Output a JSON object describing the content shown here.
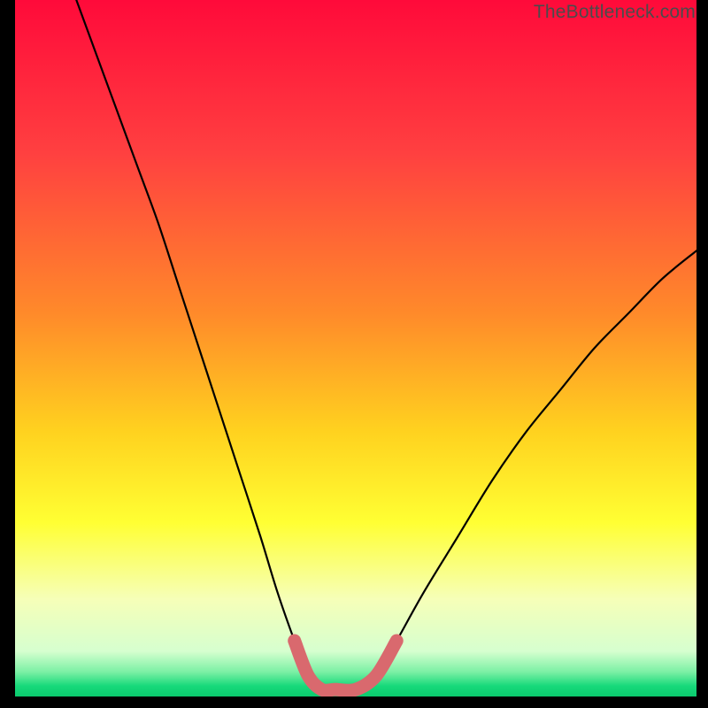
{
  "watermark": "TheBottleneck.com",
  "chart_data": {
    "type": "line",
    "title": "",
    "xlabel": "",
    "ylabel": "",
    "xlim": [
      0,
      100
    ],
    "ylim": [
      0,
      100
    ],
    "grid": false,
    "legend": false,
    "series": [
      {
        "name": "bottleneck-curve",
        "x": [
          9,
          12,
          15,
          18,
          21,
          24,
          27,
          30,
          33,
          36,
          38.5,
          41,
          43,
          45,
          47,
          50,
          53,
          56,
          60,
          65,
          70,
          75,
          80,
          85,
          90,
          95,
          100
        ],
        "y": [
          100,
          92,
          84,
          76,
          68,
          59,
          50,
          41,
          32,
          23,
          15,
          8,
          3,
          1,
          1,
          1,
          3,
          8,
          15,
          23,
          31,
          38,
          44,
          50,
          55,
          60,
          64
        ]
      }
    ],
    "highlight_band": {
      "name": "optimal-range",
      "x_start": 41,
      "x_end": 56,
      "color": "#d9696e"
    },
    "gradient_stops": [
      {
        "offset": 0.0,
        "color": "#ff0a3a"
      },
      {
        "offset": 0.22,
        "color": "#ff4040"
      },
      {
        "offset": 0.45,
        "color": "#ff8a2a"
      },
      {
        "offset": 0.62,
        "color": "#ffd21f"
      },
      {
        "offset": 0.75,
        "color": "#ffff33"
      },
      {
        "offset": 0.86,
        "color": "#f6ffb8"
      },
      {
        "offset": 0.935,
        "color": "#d6ffcf"
      },
      {
        "offset": 0.965,
        "color": "#7af0a4"
      },
      {
        "offset": 0.985,
        "color": "#16d97a"
      },
      {
        "offset": 1.0,
        "color": "#0bca6e"
      }
    ]
  }
}
